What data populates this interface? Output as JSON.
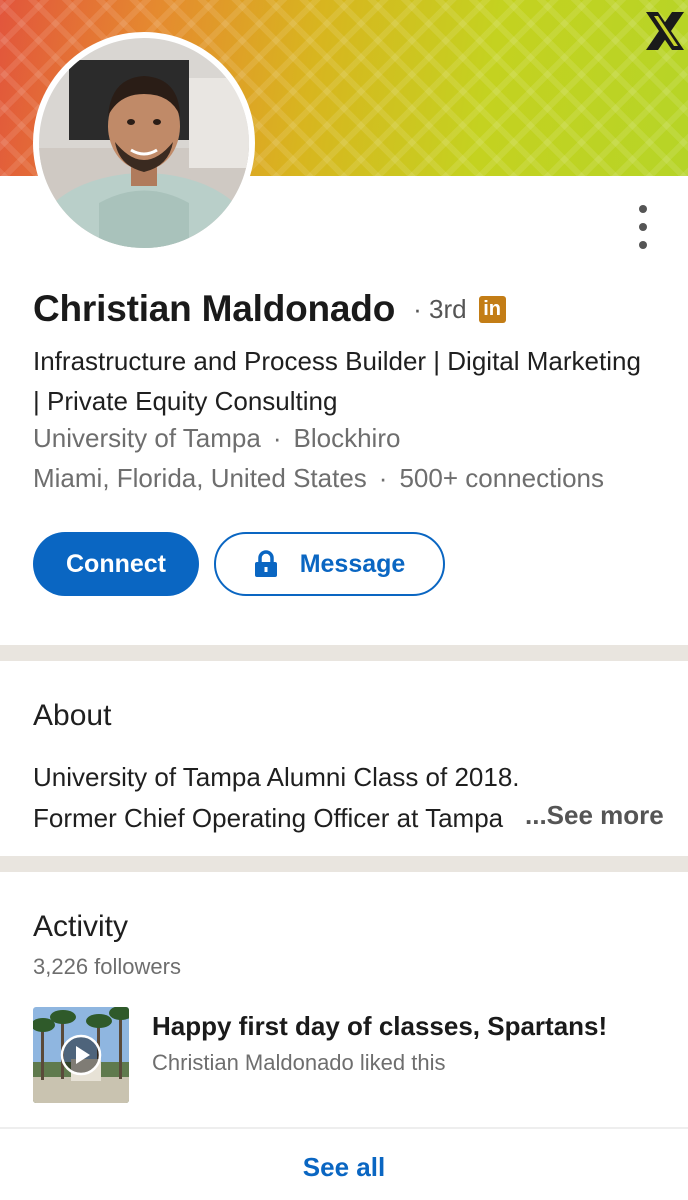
{
  "profile": {
    "name": "Christian Maldonado",
    "degree": "3rd",
    "headline": "Infrastructure and Process Builder | Digital Marketing | Private Equity Consulting",
    "school": "University of Tampa",
    "company": "Blockhiro",
    "location": "Miami, Florida, United States",
    "connections": "500+ connections",
    "badge_text": "in",
    "dot": "·"
  },
  "actions": {
    "connect_label": "Connect",
    "message_label": "Message"
  },
  "about": {
    "title": "About",
    "line1": "University of Tampa Alumni Class of 2018.",
    "line2": "Former Chief Operating Officer at Tampa",
    "see_more": "...See more"
  },
  "activity": {
    "title": "Activity",
    "followers": "3,226 followers",
    "post_title": "Happy first day of classes, Spartans!",
    "post_subtitle": "Christian Maldonado liked this",
    "see_all": "See all"
  },
  "colors": {
    "brand_blue": "#0a66c2",
    "premium_badge": "#c37d16",
    "section_separator": "#e9e5df"
  },
  "icons": {
    "banner_corner": "x-logo-icon",
    "overflow": "more-vertical-icon",
    "message_lock": "lock-icon",
    "play": "play-icon"
  }
}
